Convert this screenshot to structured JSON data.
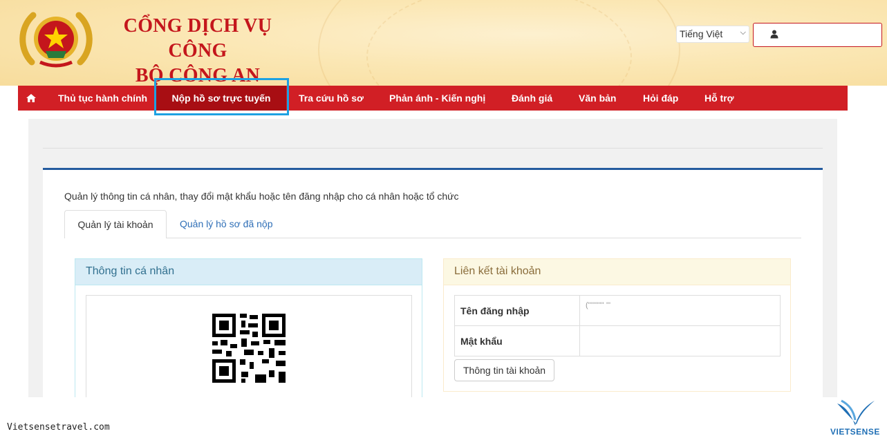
{
  "header": {
    "title_line1": "CỔNG DỊCH VỤ CÔNG",
    "title_line2": "BỘ CÔNG AN",
    "language_selected": "Tiếng Việt"
  },
  "nav": {
    "items": [
      {
        "label": "Thủ tục hành chính"
      },
      {
        "label": "Nộp hồ sơ trực tuyến"
      },
      {
        "label": "Tra cứu hồ sơ"
      },
      {
        "label": "Phản ánh - Kiến nghị"
      },
      {
        "label": "Đánh giá"
      },
      {
        "label": "Văn bản"
      },
      {
        "label": "Hỏi đáp"
      },
      {
        "label": "Hỗ trợ"
      }
    ]
  },
  "main": {
    "description": "Quản lý thông tin cá nhân, thay đổi mật khẩu hoặc tên đăng nhập cho cá nhân hoặc tổ chức",
    "tabs": [
      {
        "label": "Quản lý tài khoản"
      },
      {
        "label": "Quản lý hồ sơ đã nộp"
      }
    ],
    "personal_panel": {
      "title": "Thông tin cá nhân"
    },
    "account_panel": {
      "title": "Liên kết tài khoản",
      "rows": [
        {
          "key": "Tên đăng nhập",
          "value": "(''''''''''' '''"
        },
        {
          "key": "Mật khẩu",
          "value": ""
        }
      ],
      "button_label": "Thông tin tài khoản"
    }
  },
  "watermark": {
    "left_text": "Vietsensetravel.com",
    "right_text": "VIETSENSE"
  },
  "colors": {
    "nav_red": "#d11f25",
    "nav_active": "#a80e13",
    "highlight_blue": "#1da1e2",
    "card_border": "#235b9e"
  }
}
